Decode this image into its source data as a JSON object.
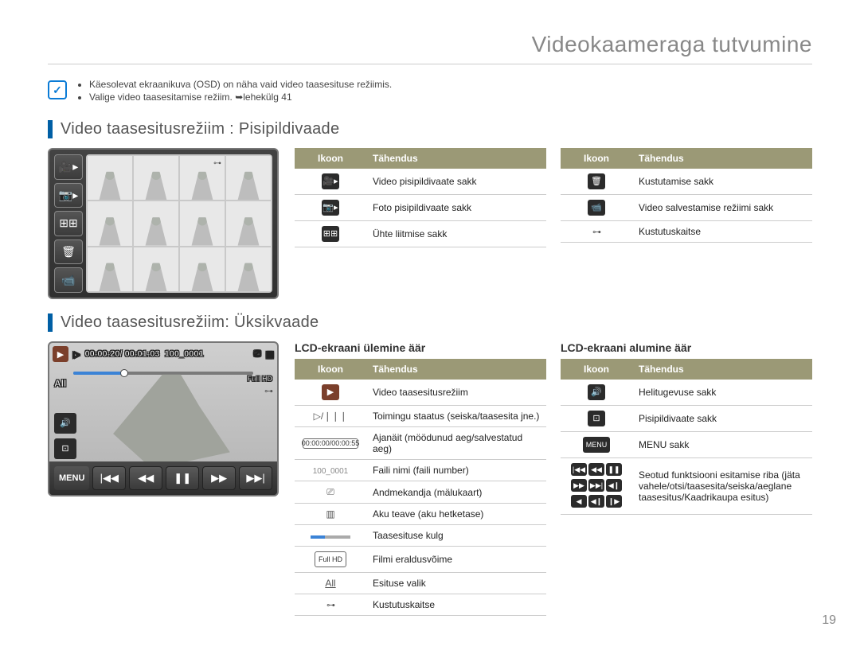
{
  "page": {
    "title": "Videokaameraga tutvumine",
    "number": "19"
  },
  "notes": {
    "items": [
      "Käesolevat ekraanikuva (OSD) on näha vaid video taasesituse režiimis.",
      "Valige video taasesitamise režiim. ➥lehekülg 41"
    ]
  },
  "section1": {
    "heading": "Video taasesitusrežiim : Pisipildivaade",
    "tableHeaders": {
      "icon": "Ikoon",
      "meaning": "Tähendus"
    },
    "left": [
      {
        "name": "video-thumb-tab-icon",
        "label": "Video pisipildivaate sakk"
      },
      {
        "name": "photo-thumb-tab-icon",
        "label": "Foto pisipildivaate sakk"
      },
      {
        "name": "combine-tab-icon",
        "label": "Ühte liitmise sakk"
      }
    ],
    "right": [
      {
        "name": "delete-tab-icon",
        "label": "Kustutamise sakk"
      },
      {
        "name": "video-record-mode-icon",
        "label": "Video salvestamise režiimi sakk"
      },
      {
        "name": "protect-icon",
        "label": "Kustutuskaitse"
      }
    ]
  },
  "section2": {
    "heading": "Video taasesitusrežiim: Üksikvaade",
    "overlay": {
      "time": "00:00:20/ 00:01:03",
      "filename": "100_0001",
      "playAll": "All",
      "menu": "MENU",
      "fullhd": "Full HD"
    },
    "upper": {
      "title": "LCD-ekraani ülemine äär",
      "rows": [
        {
          "name": "play-mode-icon",
          "label": "Video taasesitusrežiim"
        },
        {
          "name": "play-pause-status-icon",
          "label": "Toimingu staatus (seiska/taasesita jne.)"
        },
        {
          "name": "time-counter-icon",
          "text": "00:00:00/00:00:55",
          "label": "Ajanäit (möödunud aeg/salvestatud aeg)"
        },
        {
          "name": "filename-icon",
          "text": "100_0001",
          "label": "Faili nimi (faili number)"
        },
        {
          "name": "storage-icon",
          "label": "Andmekandja (mälukaart)"
        },
        {
          "name": "battery-icon",
          "label": "Aku teave (aku hetketase)"
        },
        {
          "name": "progress-icon",
          "label": "Taasesituse kulg"
        },
        {
          "name": "fullhd-icon",
          "text": "Full HD",
          "label": "Filmi eraldusvõime"
        },
        {
          "name": "play-option-icon",
          "text": "All",
          "label": "Esituse valik"
        },
        {
          "name": "protect-icon-2",
          "label": "Kustutuskaitse"
        }
      ]
    },
    "lower": {
      "title": "LCD-ekraani alumine äär",
      "rows": [
        {
          "name": "volume-icon",
          "label": "Helitugevuse sakk"
        },
        {
          "name": "thumb-view-icon",
          "label": "Pisipildivaate sakk"
        },
        {
          "name": "menu-icon",
          "text": "MENU",
          "label": "MENU sakk"
        },
        {
          "name": "playbar-icons",
          "label": "Seotud funktsiooni esitamise riba (jäta vahele/otsi/taasesita/seiska/aeglane taasesitus/Kaadrikaupa esitus)"
        }
      ]
    }
  }
}
